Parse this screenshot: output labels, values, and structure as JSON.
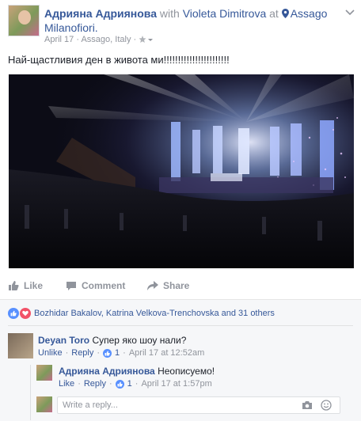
{
  "post": {
    "author": "Адрияна Адриянова",
    "with_word": "with",
    "tagged": "Violeta Dimitrova",
    "at_word": "at",
    "place": "Assago Milanofiori.",
    "date": "April 17",
    "location": "Assago, Italy",
    "text": "Най-щастливия ден в живота ми!!!!!!!!!!!!!!!!!!!!!!!"
  },
  "actions": {
    "like": "Like",
    "comment": "Comment",
    "share": "Share"
  },
  "likes_summary": "Bozhidar Bakalov, Katrina Velkova-Trenchovska and 31 others",
  "comments": [
    {
      "author": "Deyan Toro",
      "text": "Супер яко шоу нали?",
      "unlike": "Unlike",
      "reply": "Reply",
      "likes": "1",
      "time": "April 17 at 12:52am"
    },
    {
      "author": "Адрияна Адриянова",
      "text": "Неописуемо!",
      "like": "Like",
      "reply": "Reply",
      "likes": "1",
      "time": "April 17 at 1:57pm"
    }
  ],
  "reply_box": {
    "placeholder": "Write a reply..."
  },
  "icons": {
    "pin": "map-pin-icon",
    "globe": "audience-globe-icon",
    "menu": "chevron-down-icon",
    "like": "thumbs-up-icon",
    "comment": "comment-bubble-icon",
    "share": "share-arrow-icon",
    "like_reaction": "like-reaction-icon",
    "love_reaction": "love-reaction-icon",
    "camera": "camera-icon",
    "smile": "emoji-icon"
  },
  "colors": {
    "link": "#365899",
    "muted": "#90949c",
    "like_blue": "#5890ff",
    "love_red": "#f25268",
    "comments_bg": "#f6f7f9"
  }
}
